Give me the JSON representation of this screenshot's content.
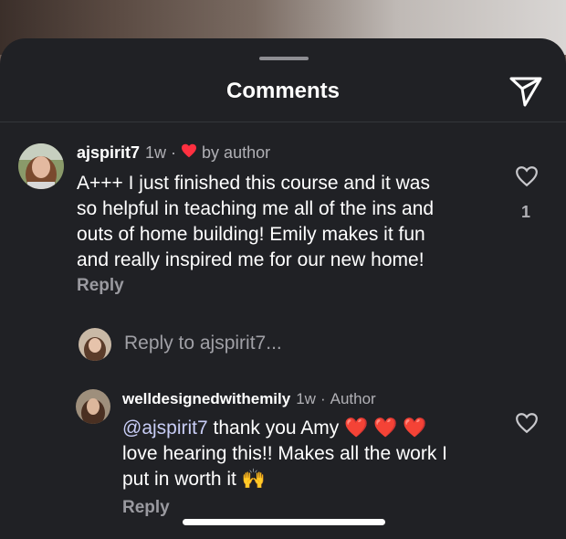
{
  "header": {
    "title": "Comments"
  },
  "comment": {
    "username": "ajspirit7",
    "time": "1w",
    "separator": "·",
    "liked_by": "by author",
    "lines": [
      "A+++ I just finished this course and it was",
      "so helpful in teaching me  all of the ins and",
      "outs of home building! Emily makes it fun",
      "and really inspired me for our new home!"
    ],
    "like_count": "1",
    "reply_label": "Reply"
  },
  "reply_prompt": "Reply to ajspirit7...",
  "author_reply": {
    "username": "welldesignedwithemily",
    "time": "1w",
    "separator": "·",
    "badge": "Author",
    "mention": "@ajspirit7",
    "line1_rest": " thank you Amy",
    "emoji_line1": "❤️ ❤️ ❤️",
    "line2": "love hearing this!! Makes all the work I",
    "line3": "put in worth it",
    "emoji_line3": "🙌",
    "reply_label": "Reply"
  },
  "colors": {
    "sheet_bg": "#202125",
    "heart_red": "#ff3040",
    "mention": "#c8cdf6",
    "muted_text": "#b0b0b5"
  },
  "icons": [
    "send-icon",
    "heart-outline-icon",
    "heart-filled-icon",
    "raising-hands-emoji"
  ]
}
